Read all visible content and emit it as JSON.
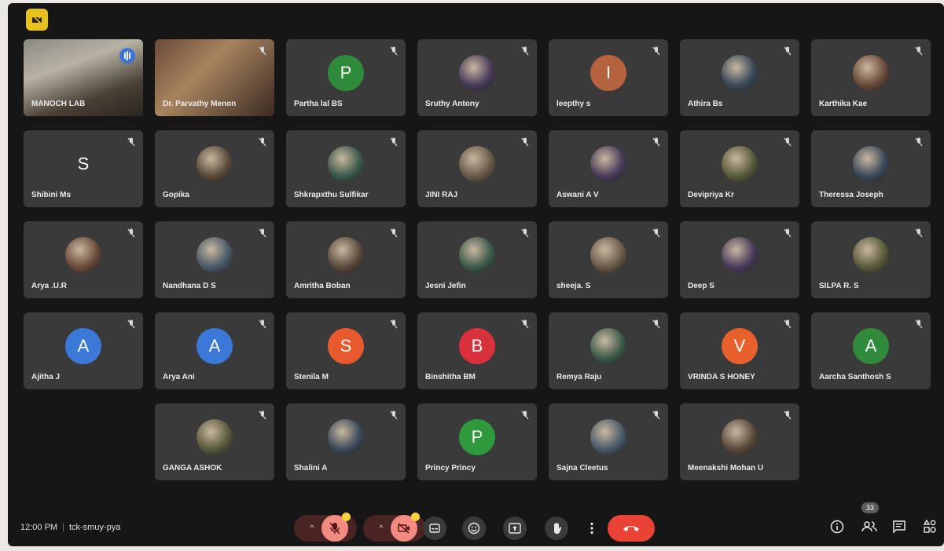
{
  "meeting": {
    "time": "12:00 PM",
    "code": "tck-smuy-pya",
    "participant_count": "33"
  },
  "colors": {
    "mute_red": "#f28b82",
    "end_call": "#ea4335",
    "speaking_blue": "#3c74d8",
    "logo_yellow": "#e8c21c"
  },
  "tiles": [
    {
      "name": "MANOCH LAB",
      "avatar": "photo",
      "speaking": true
    },
    {
      "name": "Dr. Parvathy Menon",
      "avatar": "photo"
    },
    {
      "name": "Partha lal BS",
      "initial": "P",
      "color": "#2f8a3b"
    },
    {
      "name": "Sruthy Antony",
      "avatar": "photo"
    },
    {
      "name": "leepthy s",
      "initial": "I",
      "color": "#b5623e"
    },
    {
      "name": "Athira Bs",
      "avatar": "photo"
    },
    {
      "name": "Karthika Kae",
      "avatar": "photo"
    },
    {
      "name": "Shibini Ms",
      "initial": "S",
      "color": "transparent"
    },
    {
      "name": "Gopika",
      "avatar": "photo"
    },
    {
      "name": "Shkrapxthu Sulfikar",
      "avatar": "photo"
    },
    {
      "name": "JINI RAJ",
      "avatar": "photo"
    },
    {
      "name": "Aswani A V",
      "avatar": "photo"
    },
    {
      "name": "Devipriya Kr",
      "avatar": "photo"
    },
    {
      "name": "Theressa Joseph",
      "avatar": "photo"
    },
    {
      "name": "Arya .U.R",
      "avatar": "photo"
    },
    {
      "name": "Nandhana D S",
      "avatar": "photo"
    },
    {
      "name": "Amritha Boban",
      "avatar": "photo"
    },
    {
      "name": "Jesni Jefin",
      "avatar": "photo"
    },
    {
      "name": "sheeja. S",
      "avatar": "photo"
    },
    {
      "name": "Deep S",
      "avatar": "photo"
    },
    {
      "name": "SILPA R. S",
      "avatar": "photo"
    },
    {
      "name": "Ajitha J",
      "initial": "A",
      "color": "#3b78d8"
    },
    {
      "name": "Arya Ani",
      "initial": "A",
      "color": "#3b78d8"
    },
    {
      "name": "Stenila M",
      "initial": "S",
      "color": "#e85a2e"
    },
    {
      "name": "Binshitha BM",
      "initial": "B",
      "color": "#d8313b"
    },
    {
      "name": "Remya Raju",
      "avatar": "photo"
    },
    {
      "name": "VRINDA S HONEY",
      "initial": "V",
      "color": "#e8612c"
    },
    {
      "name": "Aarcha Santhosh S",
      "initial": "A",
      "color": "#2f8a3b"
    },
    {
      "name": "GANGA ASHOK",
      "avatar": "photo"
    },
    {
      "name": "Shalini A",
      "avatar": "photo"
    },
    {
      "name": "Princy Princy",
      "initial": "P",
      "color": "#2f9a3b"
    },
    {
      "name": "Sajna Cleetus",
      "avatar": "photo"
    },
    {
      "name": "Meenakshi Mohan U",
      "avatar": "photo"
    }
  ],
  "controls": {
    "icons": [
      "mic-off-icon",
      "camera-off-icon",
      "captions-icon",
      "emoji-icon",
      "present-icon",
      "raise-hand-icon",
      "more-options-icon",
      "end-call-icon",
      "info-icon",
      "people-icon",
      "chat-icon",
      "activities-icon"
    ]
  }
}
